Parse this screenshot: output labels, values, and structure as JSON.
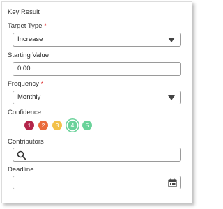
{
  "section_title": "Key Result",
  "target_type": {
    "label": "Target Type",
    "required_mark": "*",
    "value": "Increase"
  },
  "starting_value": {
    "label": "Starting Value",
    "value": "0.00"
  },
  "frequency": {
    "label": "Frequency",
    "required_mark": "*",
    "value": "Monthly"
  },
  "confidence": {
    "label": "Confidence",
    "selected": "4",
    "options": [
      {
        "label": "1",
        "color": "#b3254a"
      },
      {
        "label": "2",
        "color": "#ea6b3b"
      },
      {
        "label": "3",
        "color": "#f3c14a"
      },
      {
        "label": "4",
        "color": "#6ad29a"
      },
      {
        "label": "5",
        "color": "#6ad29a"
      }
    ]
  },
  "contributors": {
    "label": "Contributors",
    "value": "",
    "icon": "search-icon"
  },
  "deadline": {
    "label": "Deadline",
    "value": "",
    "icon": "calendar-icon"
  }
}
